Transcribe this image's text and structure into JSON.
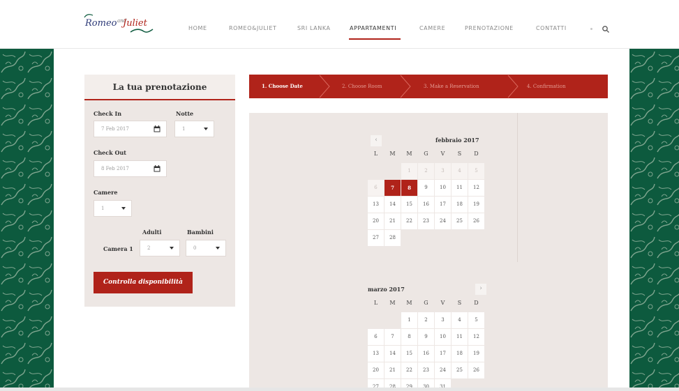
{
  "brand": {
    "logo_text_1": "Romeo",
    "logo_text_and": "and",
    "logo_text_2": "Juliet"
  },
  "nav": {
    "items": [
      "HOME",
      "ROMEO&JULIET",
      "SRI LANKA",
      "APPARTAMENTI",
      "CAMERE",
      "PRENOTAZIONE",
      "CONTATTI"
    ],
    "active": "APPARTAMENTI",
    "search_icon": "search-icon"
  },
  "booking": {
    "title": "La tua prenotazione",
    "check_in_label": "Check In",
    "check_in_value": "7 Feb 2017",
    "nights_label": "Notte",
    "nights_value": "1",
    "check_out_label": "Check Out",
    "check_out_value": "8 Feb 2017",
    "rooms_label": "Camere",
    "rooms_value": "1",
    "adults_label": "Adulti",
    "children_label": "Bambini",
    "room1_label": "Camera 1",
    "room1_adults": "2",
    "room1_children": "0",
    "submit_label": "Controlla disponibilità"
  },
  "steps": [
    {
      "label": "1. Choose Date",
      "active": true
    },
    {
      "label": "2. Choose Room",
      "active": false
    },
    {
      "label": "3. Make a Reservation",
      "active": false
    },
    {
      "label": "4. Confirmation",
      "active": false
    }
  ],
  "calendar": {
    "weekdays": [
      "L",
      "M",
      "M",
      "G",
      "V",
      "S",
      "D"
    ],
    "prev_label": "‹",
    "next_label": "›",
    "months": [
      {
        "name": "febbraio 2017",
        "first_weekday": 2,
        "days": 28,
        "past_until": 6,
        "selected": [
          7,
          8
        ]
      },
      {
        "name": "marzo 2017",
        "first_weekday": 2,
        "days": 31,
        "past_until": 0,
        "selected": []
      }
    ]
  },
  "colors": {
    "accent": "#b0231a",
    "pattern": "#0d5a3e",
    "panel": "#ede7e4"
  }
}
